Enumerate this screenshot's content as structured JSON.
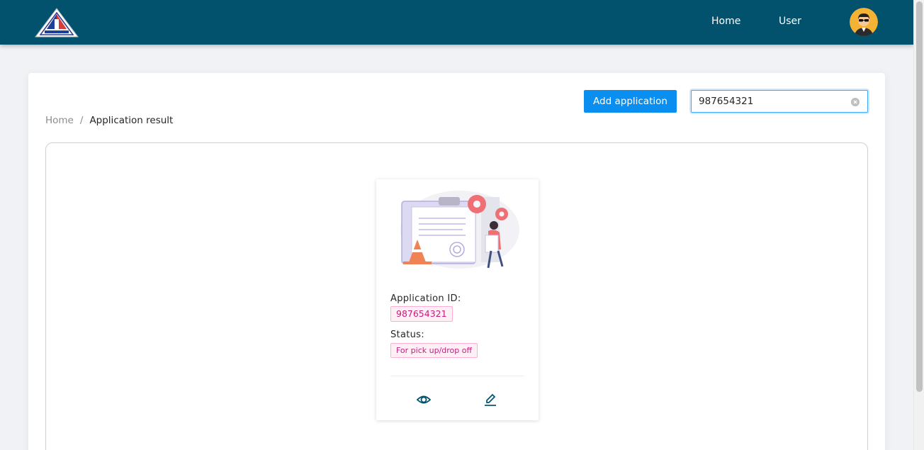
{
  "header": {
    "nav": [
      {
        "label": "Home"
      },
      {
        "label": "User"
      }
    ]
  },
  "toolbar": {
    "add_label": "Add application",
    "search_value": "987654321"
  },
  "breadcrumb": {
    "items": [
      "Home",
      "Application result"
    ],
    "separator": "/"
  },
  "application_card": {
    "id_label": "Application ID:",
    "id_value": "987654321",
    "status_label": "Status:",
    "status_value": "For pick up/drop off"
  },
  "colors": {
    "header_bg": "#02526e",
    "primary": "#0a8ff0",
    "tag_text": "#c41d7f",
    "tag_bg": "#fff0f6",
    "tag_border": "#ffadd2",
    "avatar_bg": "#f5b335"
  },
  "icons": [
    "logo-icon",
    "avatar-icon",
    "clear-icon",
    "eye-icon",
    "edit-icon",
    "illustration"
  ]
}
